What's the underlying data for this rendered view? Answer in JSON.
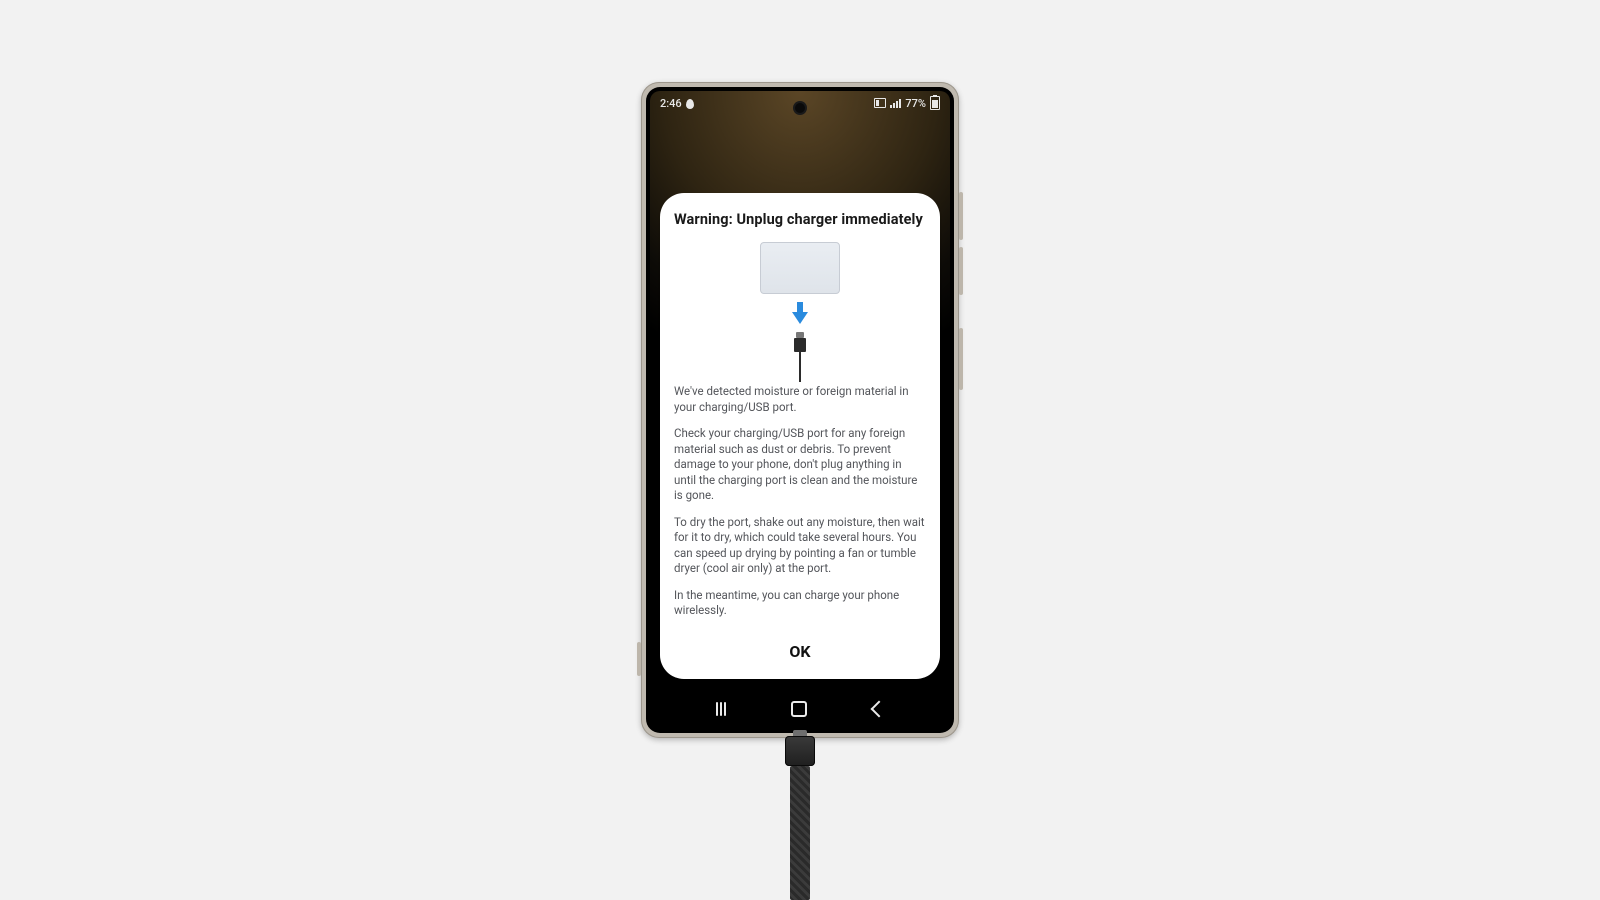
{
  "status": {
    "time": "2:46",
    "battery": "77%"
  },
  "dialog": {
    "title": "Warning: Unplug charger immediately",
    "p1": "We've detected moisture or foreign material in your charging/USB port.",
    "p2": "Check your charging/USB port for any foreign material such as dust or debris. To prevent damage to your phone, don't plug anything in until the charging port is clean and the moisture is gone.",
    "p3": "To dry the port, shake out any moisture, then wait for it to dry, which could take several hours. You can speed up drying by pointing a fan or tumble dryer (cool air only) at the port.",
    "p4": "In the meantime, you can charge your phone wirelessly.",
    "ok": "OK"
  },
  "colors": {
    "page_bg": "#f2f2f2",
    "accent_blue": "#2a8bde"
  }
}
